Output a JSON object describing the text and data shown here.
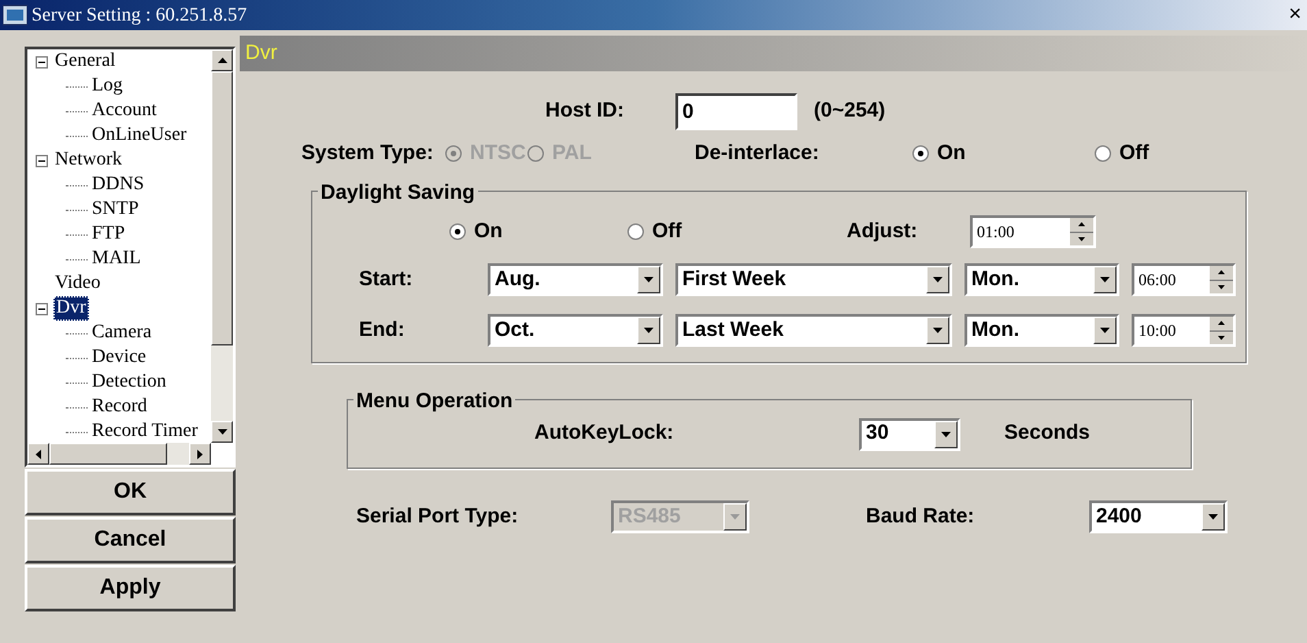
{
  "window": {
    "title": "Server Setting : 60.251.8.57",
    "close": "×"
  },
  "tree": [
    {
      "label": "General",
      "expanded": true,
      "selected": false,
      "children": [
        {
          "label": "Log",
          "selected": false
        },
        {
          "label": "Account",
          "selected": false
        },
        {
          "label": "OnLineUser",
          "selected": false
        }
      ]
    },
    {
      "label": "Network",
      "expanded": true,
      "selected": false,
      "children": [
        {
          "label": "DDNS",
          "selected": false
        },
        {
          "label": "SNTP",
          "selected": false
        },
        {
          "label": "FTP",
          "selected": false
        },
        {
          "label": "MAIL",
          "selected": false
        }
      ]
    },
    {
      "label": "Video",
      "selected": false
    },
    {
      "label": "Dvr",
      "expanded": true,
      "selected": true,
      "children": [
        {
          "label": "Camera",
          "selected": false
        },
        {
          "label": "Device",
          "selected": false
        },
        {
          "label": "Detection",
          "selected": false
        },
        {
          "label": "Record",
          "selected": false
        },
        {
          "label": "Record Timer",
          "selected": false
        }
      ]
    }
  ],
  "buttons": [
    "OK",
    "Cancel",
    "Apply"
  ],
  "panel": {
    "title": "Dvr",
    "host_id": {
      "label": "Host ID:",
      "value": "0",
      "range": "(0~254)"
    },
    "system_type": {
      "label": "System Type:",
      "disabled": true,
      "options": [
        {
          "label": "NTSC",
          "selected": true
        },
        {
          "label": "PAL",
          "selected": false
        }
      ]
    },
    "deinterlace": {
      "label": "De-interlace:",
      "options": [
        {
          "label": "On",
          "selected": true
        },
        {
          "label": "Off",
          "selected": false
        }
      ]
    },
    "daylight_saving": {
      "title": "Daylight Saving",
      "options": [
        {
          "label": "On",
          "selected": true
        },
        {
          "label": "Off",
          "selected": false
        }
      ],
      "adjust_label": "Adjust:",
      "adjust_value": "01:00",
      "rows": [
        {
          "label": "Start:",
          "month": "Aug.",
          "week": "First Week",
          "day": "Mon.",
          "time": "06:00"
        },
        {
          "label": "End:",
          "month": "Oct.",
          "week": "Last Week",
          "day": "Mon.",
          "time": "10:00"
        }
      ]
    },
    "menu_operation": {
      "title": "Menu Operation",
      "label": "AutoKeyLock:",
      "value": "30",
      "unit": "Seconds"
    },
    "serial_port": {
      "label": "Serial Port Type:",
      "value": "RS485",
      "disabled": true
    },
    "baud_rate": {
      "label": "Baud Rate:",
      "value": "2400",
      "disabled": false
    }
  }
}
